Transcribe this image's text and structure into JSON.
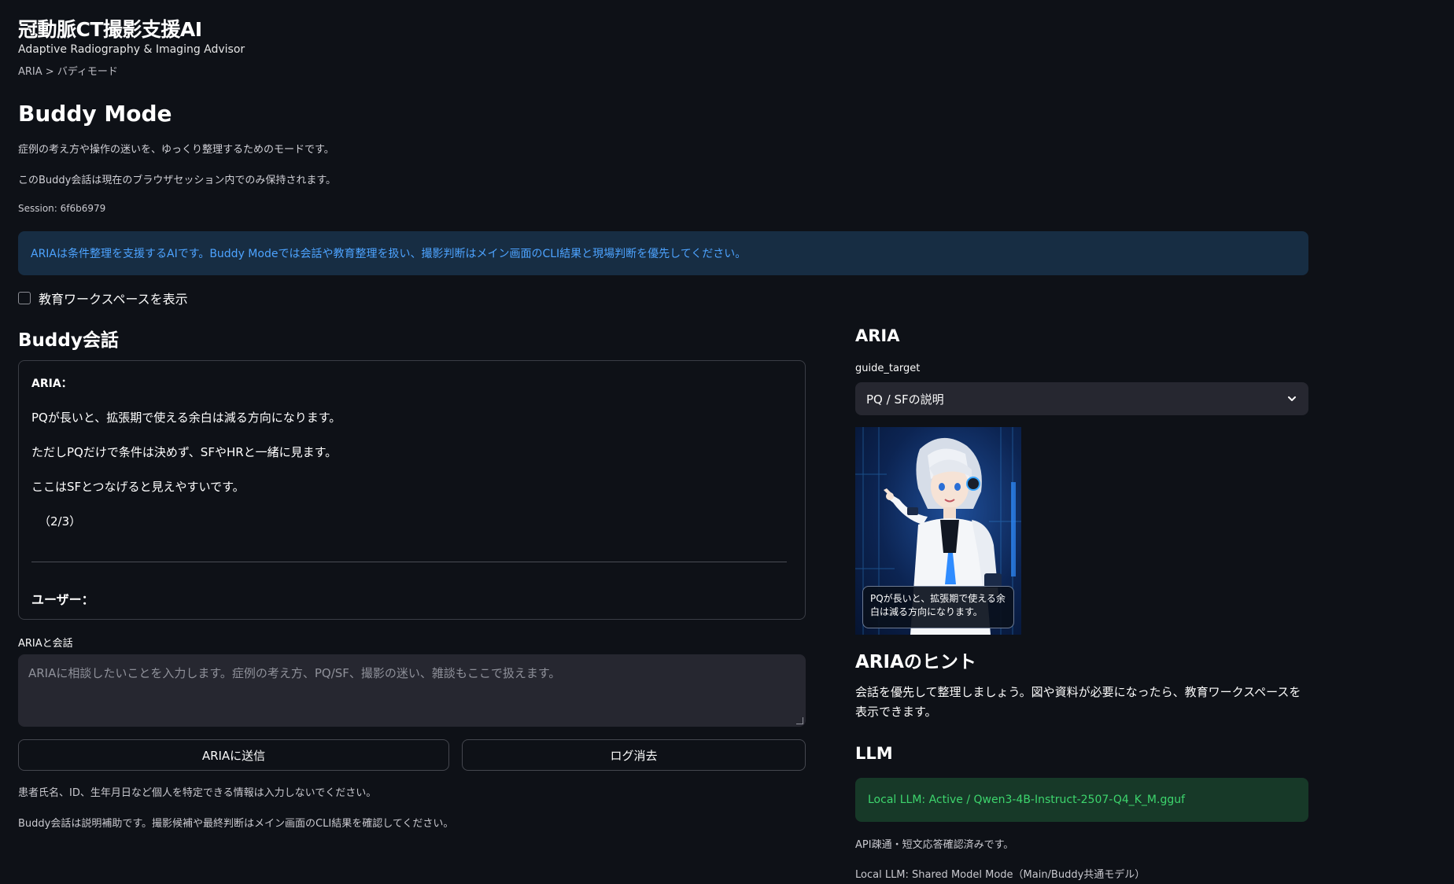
{
  "header": {
    "title": "冠動脈CT撮影支援AI",
    "subtitle": "Adaptive Radiography & Imaging Advisor",
    "breadcrumb": "ARIA > バディモード"
  },
  "page": {
    "title": "Buddy Mode",
    "desc1": "症例の考え方や操作の迷いを、ゆっくり整理するためのモードです。",
    "desc2": "このBuddy会話は現在のブラウザセッション内でのみ保持されます。",
    "session": "Session: 6f6b6979"
  },
  "info": {
    "text": "ARIAは条件整理を支援するAIです。Buddy Modeでは会話や教育整理を扱い、撮影判断はメイン画面のCLI結果と現場判断を優先してください。",
    "color": "#4da3ff",
    "background": "#172d43"
  },
  "workspace_checkbox": {
    "label": "教育ワークスペースを表示",
    "checked": false
  },
  "chat": {
    "title": "Buddy会話",
    "aria_speaker": "ARIA：",
    "lines": [
      "PQが長いと、拡張期で使える余白は減る方向になります。",
      "ただしPQだけで条件は決めず、SFやHRと一緒に見ます。",
      "ここはSFとつなげると見えやすいです。",
      "（2/3）"
    ],
    "user_speaker": "ユーザー："
  },
  "input": {
    "label": "ARIAと会話",
    "placeholder": "ARIAに相談したいことを入力します。症例の考え方、PQ/SF、撮影の迷い、雑談もここで扱えます。",
    "value": ""
  },
  "buttons": {
    "send": "ARIAに送信",
    "clear": "ログ消去"
  },
  "footnotes": {
    "f1": "患者氏名、ID、生年月日など個人を特定できる情報は入力しないでください。",
    "f2": "Buddy会話は説明補助です。撮影候補や最終判断はメイン画面のCLI結果を確認してください。"
  },
  "aria_panel": {
    "title": "ARIA",
    "select_label": "guide_target",
    "select_value": "PQ / SFの説明",
    "bubble": "PQが長いと、拡張期で使える余白は減る方向になります。"
  },
  "hint": {
    "title": "ARIAのヒント",
    "text": "会話を優先して整理しましょう。図や資料が必要になったら、教育ワークスペースを表示できます。"
  },
  "llm": {
    "title": "LLM",
    "status": "Local LLM: Active / Qwen3-4B-Instruct-2507-Q4_K_M.gguf",
    "status_color": "#3dd56d",
    "note1": "API疎通・短文応答確認済みです。",
    "note2": "Local LLM: Shared Model Mode（Main/Buddy共通モデル）"
  },
  "icons": {
    "select_chevron": "chevron-down-icon",
    "avatar": "aria-avatar-illustration"
  }
}
